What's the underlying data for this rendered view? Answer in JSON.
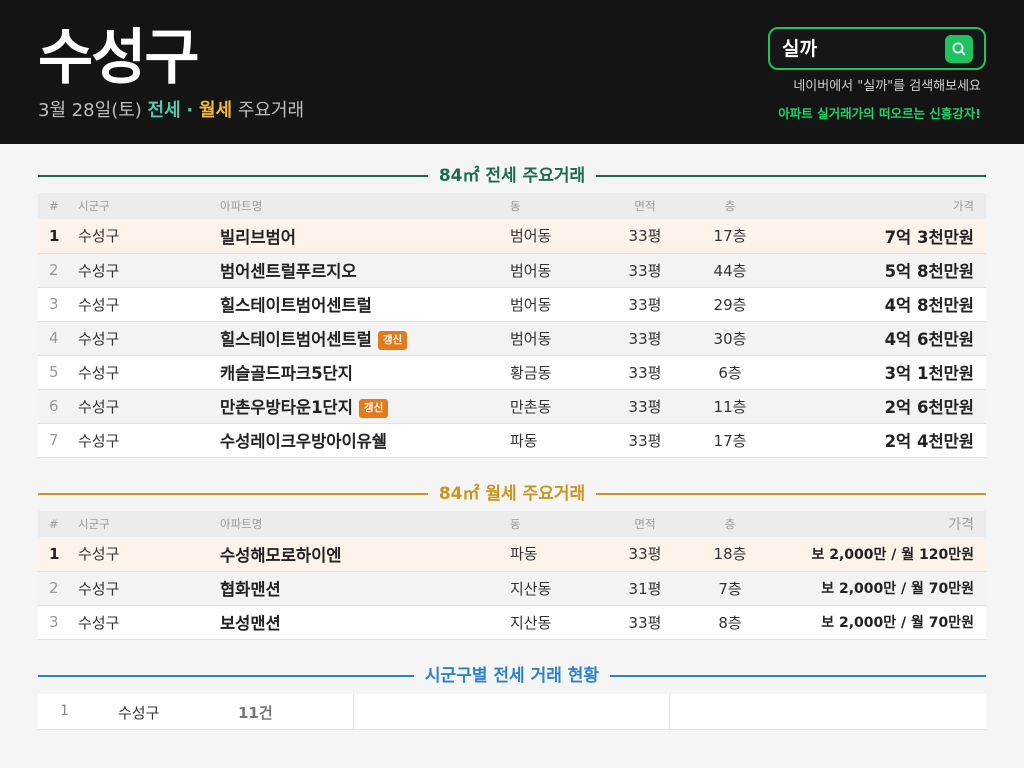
{
  "header": {
    "title": "수성구",
    "date": "3월 28일(토)",
    "jeonse": "전세",
    "sep": "·",
    "wolse": "월세",
    "suffix": "주요거래"
  },
  "search": {
    "query": "실까",
    "hint": "네이버에서 \"실까\"를 검색해보세요",
    "slogan": "아파트 실거래가의 떠오르는 신흥강자!"
  },
  "colors": {
    "jeonse_accent": "#1f6b4e",
    "wolse_accent": "#c8961e",
    "region_accent": "#2f82c8",
    "badge": "#e27b1c",
    "search_green": "#1ec25e"
  },
  "columns": {
    "num": "#",
    "city": "시군구",
    "apt": "아파트명",
    "dong": "동",
    "area": "면적",
    "floor": "층",
    "price": "가격"
  },
  "jeonse": {
    "title": "84㎡ 전세 주요거래",
    "rows": [
      {
        "num": "1",
        "city": "수성구",
        "apt": "빌리브범어",
        "dong": "범어동",
        "area": "33평",
        "floor": "17층",
        "price": "7억 3천만원",
        "badge": ""
      },
      {
        "num": "2",
        "city": "수성구",
        "apt": "범어센트럴푸르지오",
        "dong": "범어동",
        "area": "33평",
        "floor": "44층",
        "price": "5억 8천만원",
        "badge": ""
      },
      {
        "num": "3",
        "city": "수성구",
        "apt": "힐스테이트범어센트럴",
        "dong": "범어동",
        "area": "33평",
        "floor": "29층",
        "price": "4억 8천만원",
        "badge": ""
      },
      {
        "num": "4",
        "city": "수성구",
        "apt": "힐스테이트범어센트럴",
        "dong": "범어동",
        "area": "33평",
        "floor": "30층",
        "price": "4억 6천만원",
        "badge": "갱신"
      },
      {
        "num": "5",
        "city": "수성구",
        "apt": "캐슬골드파크5단지",
        "dong": "황금동",
        "area": "33평",
        "floor": "6층",
        "price": "3억 1천만원",
        "badge": ""
      },
      {
        "num": "6",
        "city": "수성구",
        "apt": "만촌우방타운1단지",
        "dong": "만촌동",
        "area": "33평",
        "floor": "11층",
        "price": "2억 6천만원",
        "badge": "갱신"
      },
      {
        "num": "7",
        "city": "수성구",
        "apt": "수성레이크우방아이유쉘",
        "dong": "파동",
        "area": "33평",
        "floor": "17층",
        "price": "2억 4천만원",
        "badge": ""
      }
    ]
  },
  "wolse": {
    "title": "84㎡ 월세 주요거래",
    "rows": [
      {
        "num": "1",
        "city": "수성구",
        "apt": "수성해모로하이엔",
        "dong": "파동",
        "area": "33평",
        "floor": "18층",
        "price": "보 2,000만 / 월 120만원",
        "badge": ""
      },
      {
        "num": "2",
        "city": "수성구",
        "apt": "협화맨션",
        "dong": "지산동",
        "area": "31평",
        "floor": "7층",
        "price": "보 2,000만 / 월 70만원",
        "badge": ""
      },
      {
        "num": "3",
        "city": "수성구",
        "apt": "보성맨션",
        "dong": "지산동",
        "area": "33평",
        "floor": "8층",
        "price": "보 2,000만 / 월 70만원",
        "badge": ""
      }
    ]
  },
  "region": {
    "title": "시군구별 전세 거래 현황",
    "items": [
      {
        "num": "1",
        "city": "수성구",
        "count": "11건"
      }
    ]
  }
}
